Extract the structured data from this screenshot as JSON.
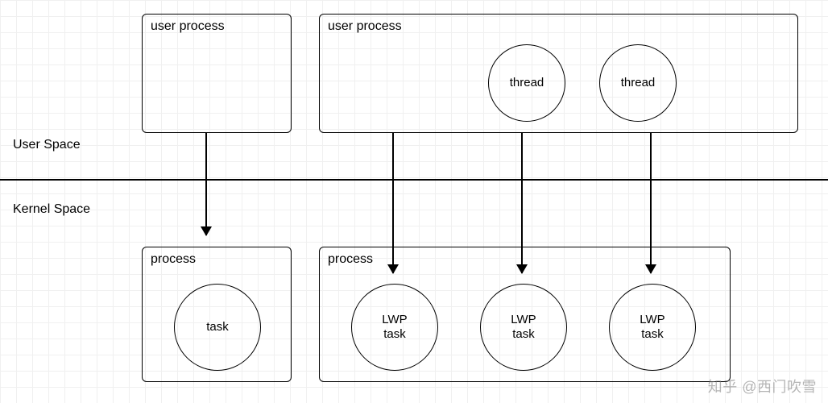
{
  "labels": {
    "user_space": "User  Space",
    "kernel_space": "Kernel Space"
  },
  "user": {
    "left": {
      "title": "user process"
    },
    "right": {
      "title": "user process",
      "threads": [
        "thread",
        "thread"
      ]
    }
  },
  "kernel": {
    "left": {
      "title": "process",
      "task": "task"
    },
    "right": {
      "title": "process",
      "tasks": [
        "LWP\ntask",
        "LWP\ntask",
        "LWP\ntask"
      ]
    }
  },
  "watermark": "知乎 @西门吹雪"
}
